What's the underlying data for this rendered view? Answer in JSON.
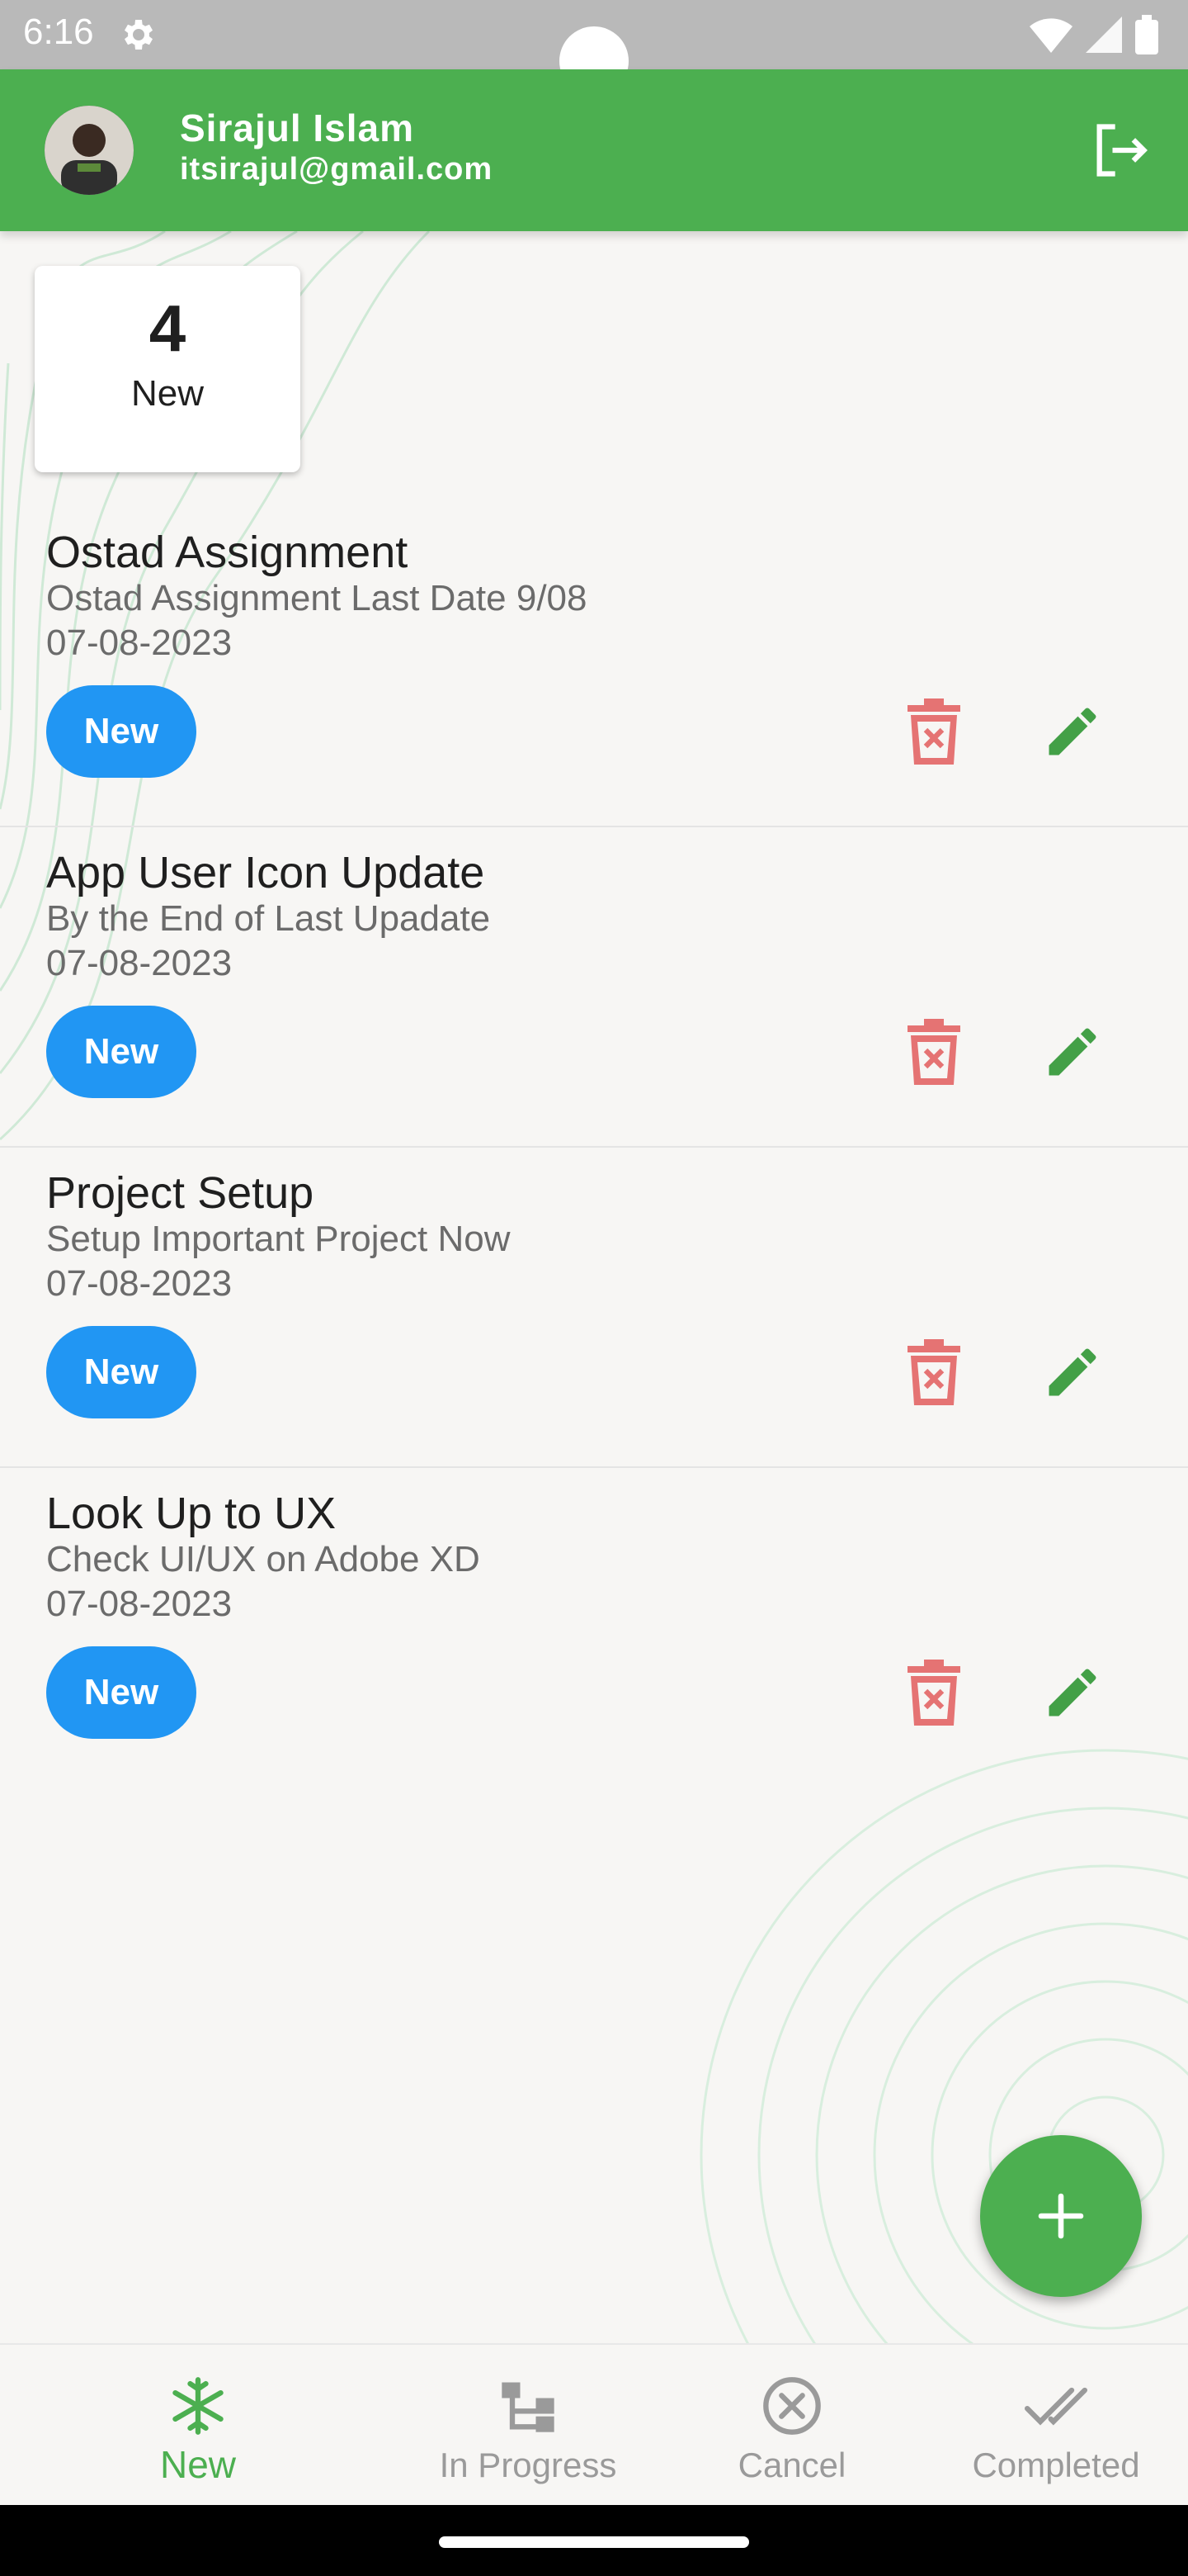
{
  "status_bar": {
    "time": "6:16"
  },
  "app_bar": {
    "user_name": "Sirajul Islam",
    "user_email": "itsirajul@gmail.com"
  },
  "summary": {
    "count": "4",
    "label": "New"
  },
  "tasks": [
    {
      "title": "Ostad Assignment",
      "description": "Ostad Assignment Last Date 9/08",
      "date": "07-08-2023",
      "status": "New"
    },
    {
      "title": "App User Icon Update",
      "description": "By the End of Last Upadate",
      "date": "07-08-2023",
      "status": "New"
    },
    {
      "title": "Project Setup",
      "description": "Setup Important Project Now",
      "date": "07-08-2023",
      "status": "New"
    },
    {
      "title": "Look Up to UX",
      "description": "Check UI/UX on Adobe XD",
      "date": "07-08-2023",
      "status": "New"
    }
  ],
  "bottom_nav": {
    "items": [
      {
        "label": "New",
        "icon": "snowflake-icon",
        "active": true
      },
      {
        "label": "In Progress",
        "icon": "hierarchy-icon",
        "active": false
      },
      {
        "label": "Cancel",
        "icon": "cancel-circle-icon",
        "active": false
      },
      {
        "label": "Completed",
        "icon": "double-check-icon",
        "active": false
      }
    ]
  },
  "colors": {
    "primary": "#4caf50",
    "badge": "#2196f3",
    "delete": "#e57373",
    "edit": "#43a047",
    "inactive": "#9a9a9a"
  }
}
